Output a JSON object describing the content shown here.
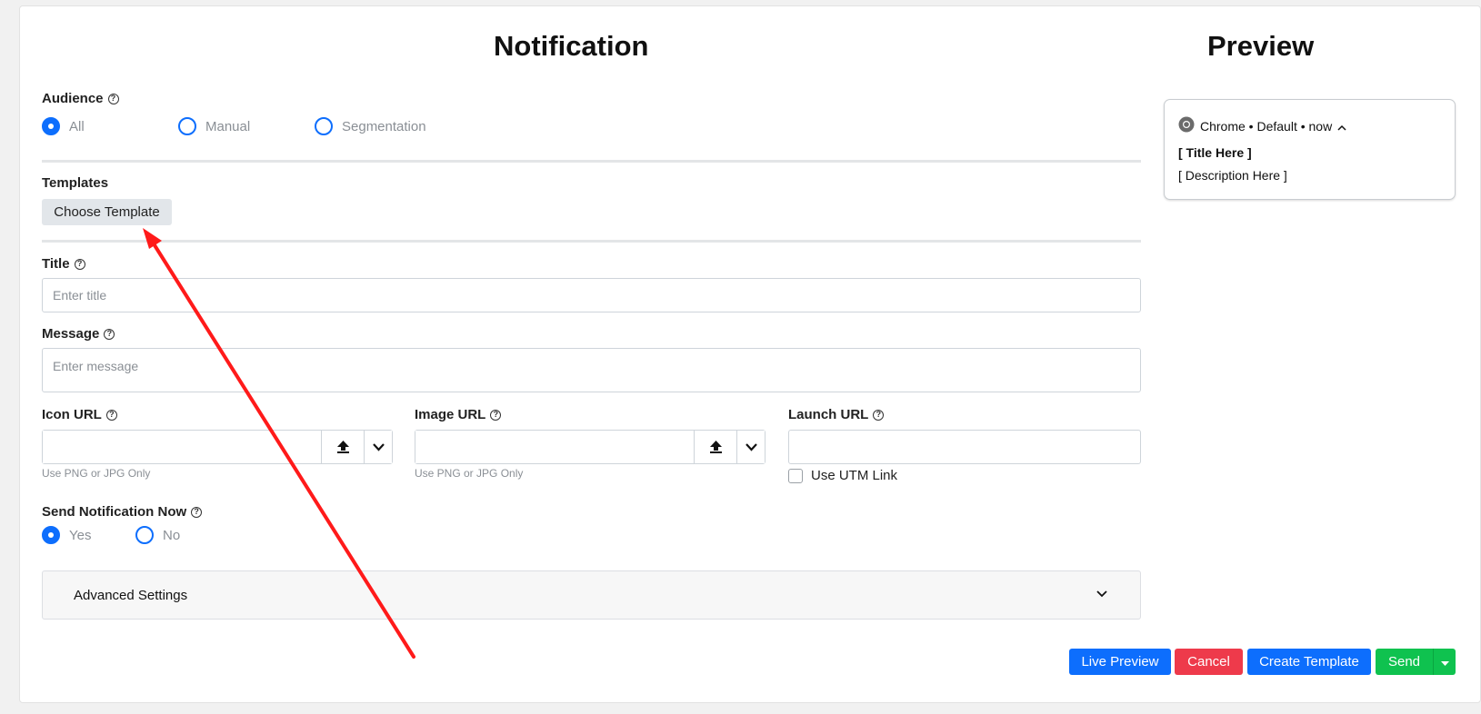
{
  "notification": {
    "heading": "Notification",
    "audience": {
      "label": "Audience",
      "options": [
        {
          "label": "All",
          "checked": true
        },
        {
          "label": "Manual",
          "checked": false
        },
        {
          "label": "Segmentation",
          "checked": false
        }
      ]
    },
    "templates": {
      "label": "Templates",
      "button": "Choose Template"
    },
    "title": {
      "label": "Title",
      "placeholder": "Enter title"
    },
    "message": {
      "label": "Message",
      "placeholder": "Enter message"
    },
    "icon_url": {
      "label": "Icon URL",
      "hint": "Use PNG or JPG Only"
    },
    "image_url": {
      "label": "Image URL",
      "hint": "Use PNG or JPG Only"
    },
    "launch_url": {
      "label": "Launch URL",
      "utm_label": "Use UTM Link"
    },
    "send_now": {
      "label": "Send Notification Now",
      "options": [
        {
          "label": "Yes",
          "checked": true
        },
        {
          "label": "No",
          "checked": false
        }
      ]
    },
    "advanced": {
      "label": "Advanced Settings"
    }
  },
  "preview": {
    "heading": "Preview",
    "browser_line": "Chrome • Default • now",
    "title": "[ Title Here ]",
    "description": "[ Description Here ]"
  },
  "actions": {
    "live_preview": "Live Preview",
    "cancel": "Cancel",
    "create_template": "Create Template",
    "send": "Send"
  },
  "colors": {
    "primary": "#0d6efd",
    "danger": "#ee3a4b",
    "success": "#0fc24f",
    "annotation_arrow": "#ff1a1a"
  },
  "icons": {
    "help": "question-circle-icon",
    "upload": "upload-icon",
    "dropdown": "chevron-down-icon",
    "browser": "chrome-icon",
    "collapse": "chevron-up-icon",
    "send_menu": "caret-down-icon"
  }
}
